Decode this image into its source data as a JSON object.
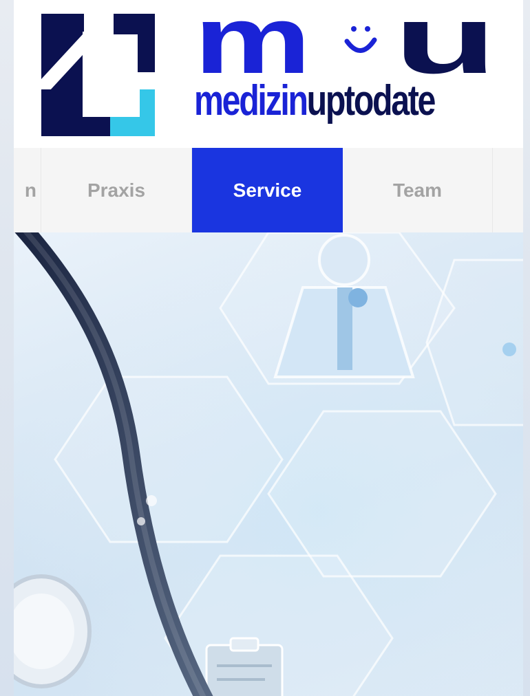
{
  "brand": {
    "logo_letters": "m u",
    "logo_word_1": "medizin",
    "logo_word_2": "uptodate",
    "colors": {
      "primary_blue": "#1a23d6",
      "dark_navy": "#0b1150",
      "cyan": "#35c7e8",
      "nav_active": "#1a35e0"
    }
  },
  "nav": {
    "items": [
      {
        "label": "n"
      },
      {
        "label": "Praxis"
      },
      {
        "label": "Service",
        "active": true
      },
      {
        "label": "Team"
      }
    ]
  },
  "hero": {
    "image": "medical-hexagon-stethoscope-illustration"
  }
}
